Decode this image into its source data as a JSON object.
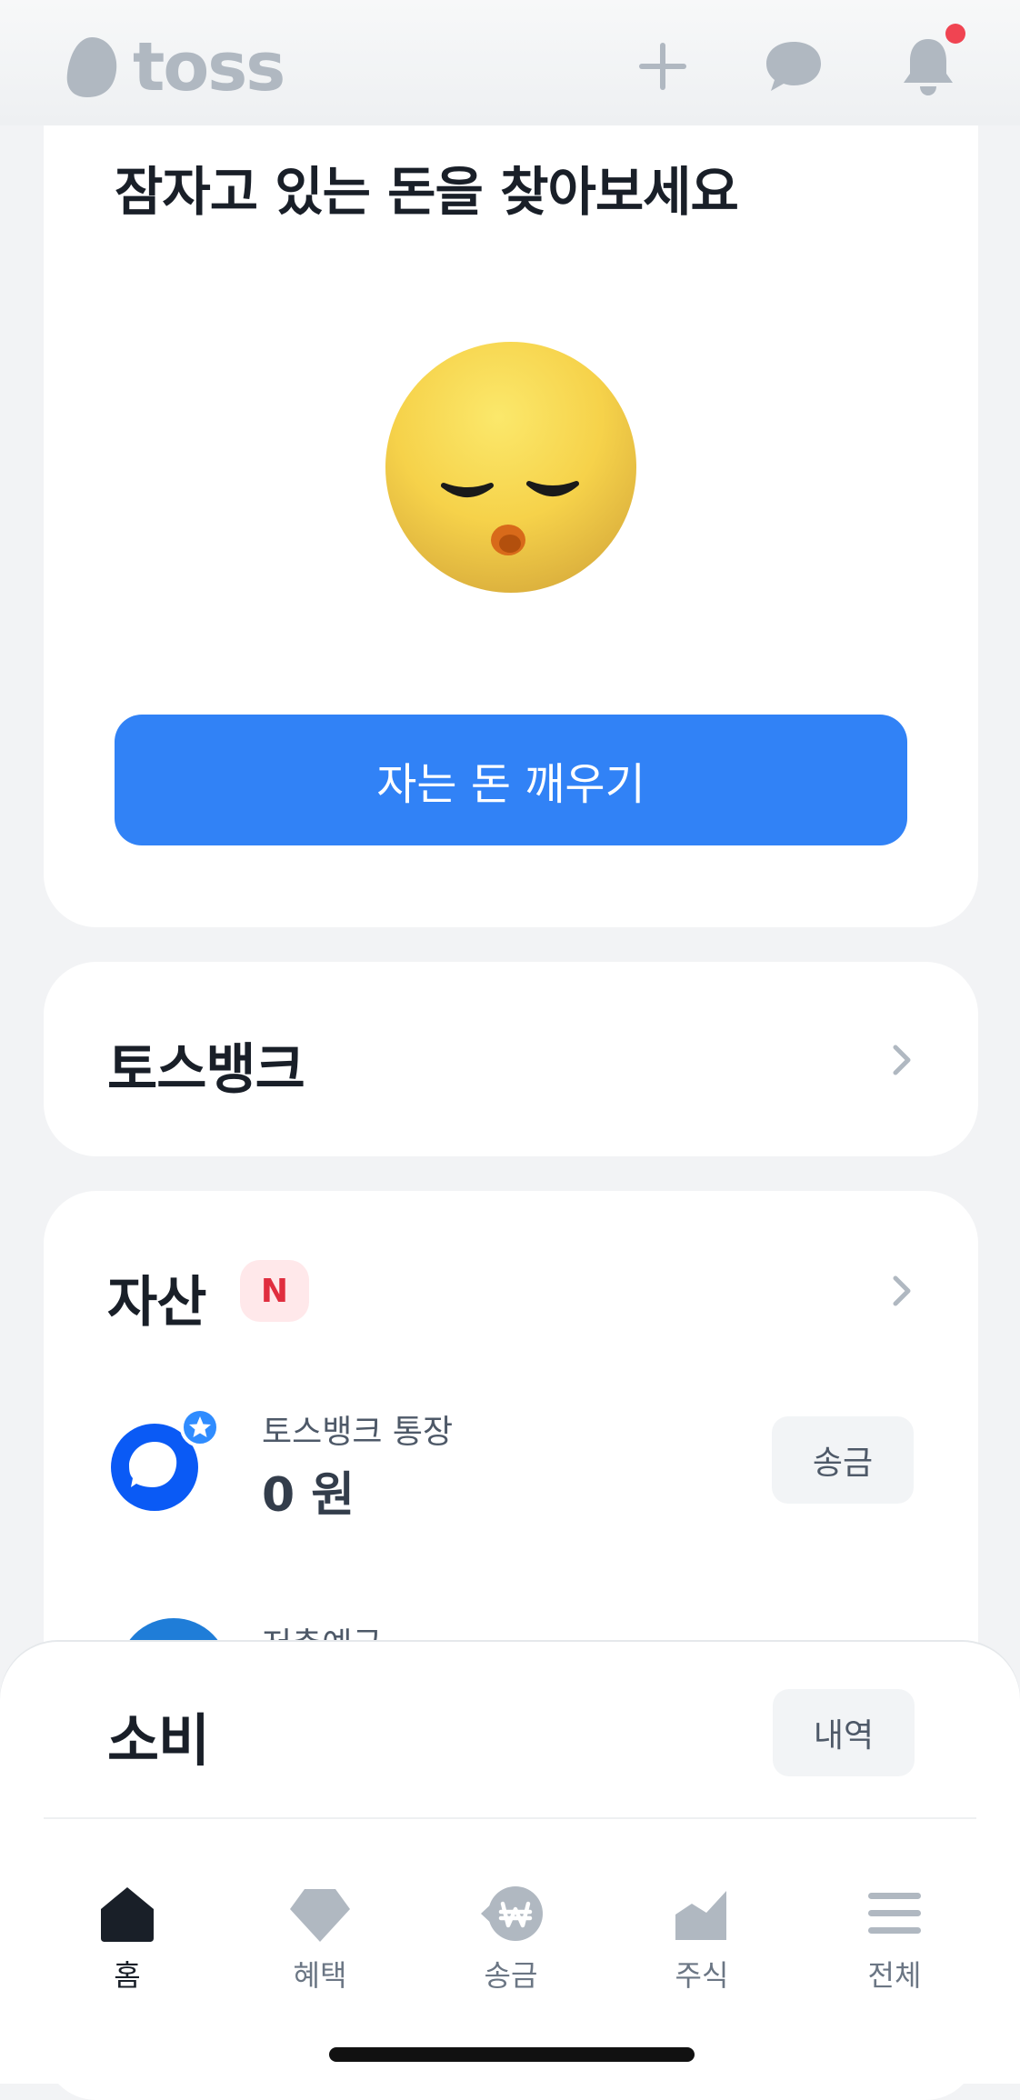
{
  "app": {
    "logo_text": "toss"
  },
  "hero": {
    "title": "잠자고 있는 돈을 찾아보세요",
    "cta_label": "자는 돈 깨우기"
  },
  "bank_section": {
    "title": "토스뱅크"
  },
  "assets": {
    "title": "자산",
    "badge": "N",
    "accounts": [
      {
        "name": "토스뱅크 통장",
        "balance": "0 원",
        "action": "송금"
      },
      {
        "name": "저축예금"
      }
    ]
  },
  "spending": {
    "title": "소비",
    "action": "내역"
  },
  "tabbar": {
    "tabs": [
      {
        "label": "홈",
        "icon": "home-icon",
        "active": true
      },
      {
        "label": "혜택",
        "icon": "diamond-icon",
        "active": false
      },
      {
        "label": "송금",
        "icon": "won-transfer-icon",
        "active": false
      },
      {
        "label": "주식",
        "icon": "stock-chart-icon",
        "active": false
      },
      {
        "label": "전체",
        "icon": "menu-icon",
        "active": false
      }
    ]
  },
  "colors": {
    "primary": "#3182f6",
    "background": "#f2f3f5",
    "badge_bg": "#ffe8ea",
    "badge_text": "#e02e3f",
    "notification_dot": "#f04452"
  }
}
